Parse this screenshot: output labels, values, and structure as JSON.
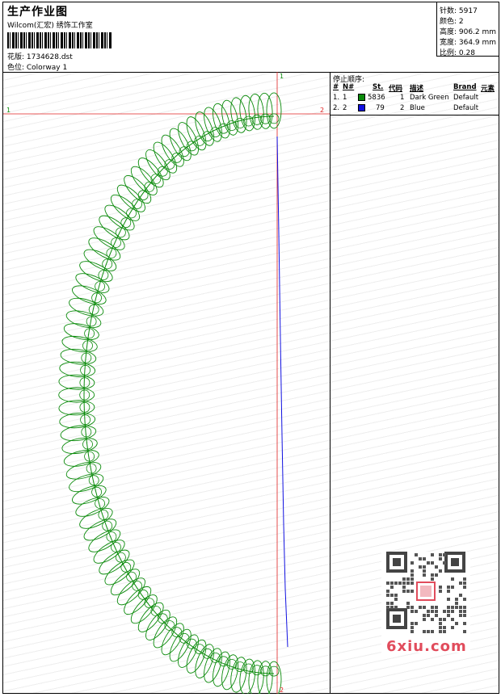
{
  "header": {
    "title": "生产作业图",
    "company": "Wilcom(汇宏) 绣饰工作室",
    "design_label": "花版: 1734628.dst",
    "colorway_label": "色位: Colorway 1"
  },
  "stats": {
    "stitches": "针数: 5917",
    "colors": "颜色: 2",
    "height": "高度: 906.2 mm",
    "width": "宽度: 364.9 mm",
    "scale": "比例: 0.28"
  },
  "stop_sequence": {
    "title": "停止顺序:",
    "headers": [
      "#",
      "N#",
      "St.",
      "代码",
      "描述",
      "Brand",
      "元素"
    ],
    "rows": [
      {
        "num": "1.",
        "n": "1",
        "color": "#0a8a0a",
        "st": "5836",
        "code": "1",
        "desc": "Dark Green",
        "brand": "Default"
      },
      {
        "num": "2.",
        "n": "2",
        "color": "#1010e0",
        "st": "79",
        "code": "2",
        "desc": "Blue",
        "brand": "Default"
      }
    ]
  },
  "axis_labels": {
    "top1": "1",
    "left1": "1",
    "right2": "2",
    "bottom2": "2"
  },
  "watermark": {
    "site": "6xiu.com"
  }
}
